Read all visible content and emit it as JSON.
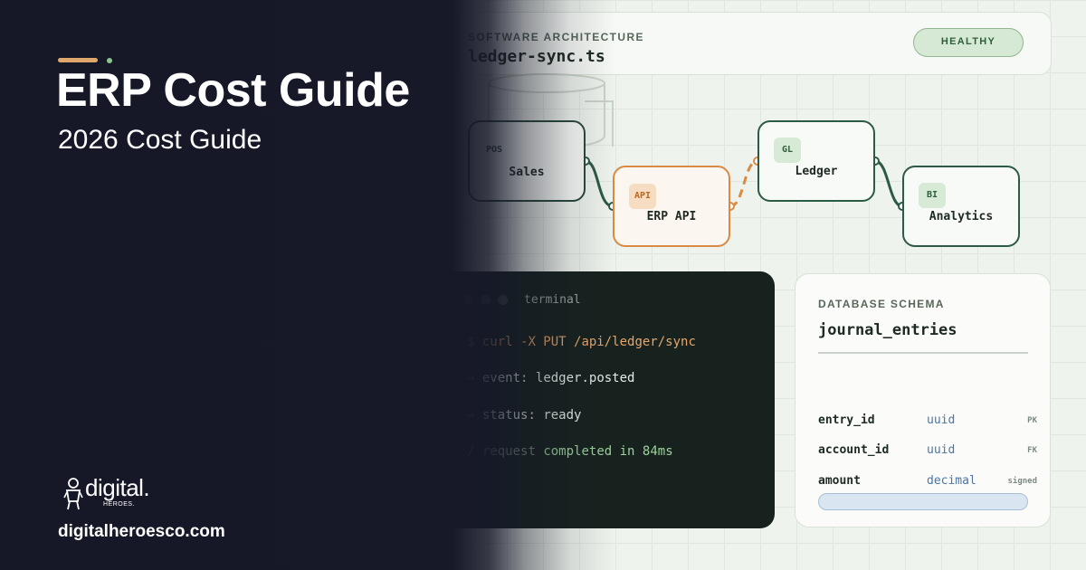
{
  "hero": {
    "title": "ERP Cost Guide",
    "subtitle": "2026 Cost Guide"
  },
  "brand": {
    "logo_word": "digital.",
    "logo_sub": "HEROES.",
    "url": "digitalheroesco.com"
  },
  "header": {
    "kicker": "SOFTWARE ARCHITECTURE",
    "file": "ledger-sync.ts",
    "status": "HEALTHY"
  },
  "diagram": {
    "nodes": [
      {
        "tag": "POS",
        "label": "Sales"
      },
      {
        "tag": "API",
        "label": "ERP API"
      },
      {
        "tag": "GL",
        "label": "Ledger"
      },
      {
        "tag": "BI",
        "label": "Analytics"
      }
    ]
  },
  "terminal": {
    "title": "terminal",
    "lines": [
      {
        "prefix": "$",
        "text": "curl -X PUT /api/ledger/sync"
      },
      {
        "prefix": "→",
        "label": "event:",
        "value": "ledger.posted"
      },
      {
        "prefix": "→",
        "label": "status:",
        "value": "ready"
      },
      {
        "prefix": "/",
        "label": "request",
        "value": "completed in 84ms"
      }
    ]
  },
  "schema": {
    "kicker": "DATABASE SCHEMA",
    "table": "journal_entries",
    "rows": [
      {
        "name": "entry_id",
        "type": "uuid",
        "key": "PK"
      },
      {
        "name": "account_id",
        "type": "uuid",
        "key": "FK"
      },
      {
        "name": "amount",
        "type": "decimal",
        "key": "signed"
      }
    ]
  },
  "colors": {
    "panel": "#161828",
    "accent_orange": "#e0a86c",
    "accent_green": "#8cc58d",
    "node_border": "#2d5a45"
  }
}
